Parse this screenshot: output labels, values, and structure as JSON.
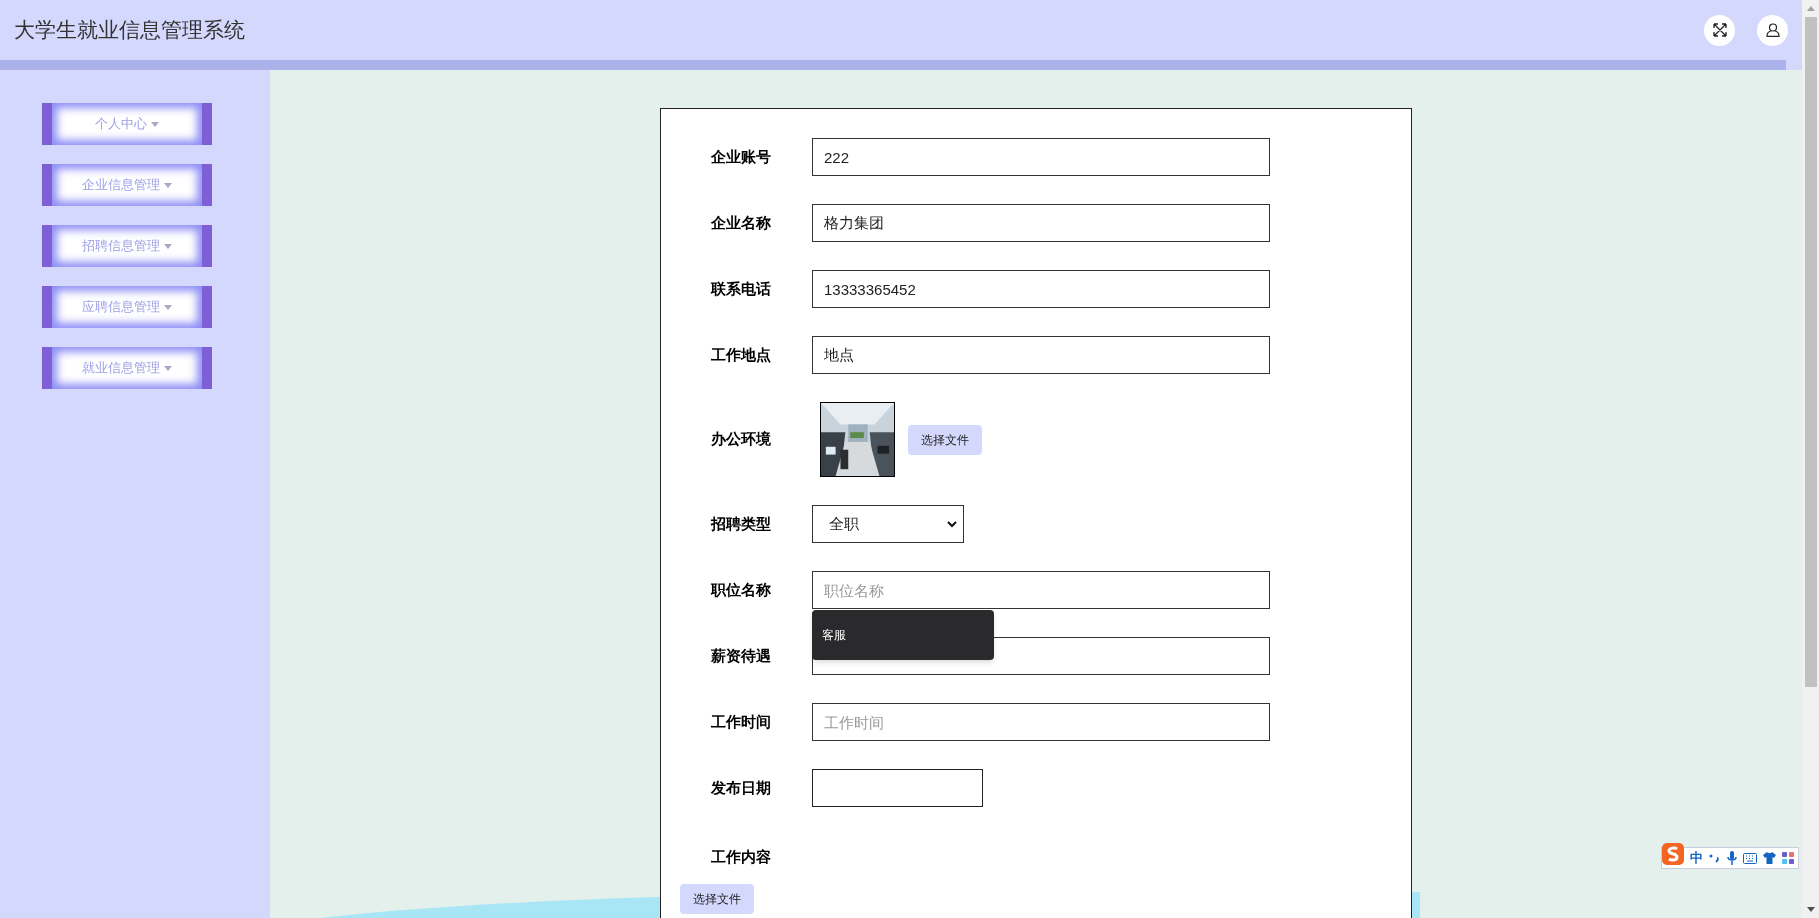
{
  "header": {
    "title": "大学生就业信息管理系统"
  },
  "sidebar": {
    "items": [
      {
        "label": "个人中心"
      },
      {
        "label": "企业信息管理"
      },
      {
        "label": "招聘信息管理"
      },
      {
        "label": "应聘信息管理"
      },
      {
        "label": "就业信息管理"
      }
    ]
  },
  "form": {
    "fields": [
      {
        "kind": "input",
        "label": "企业账号",
        "value": "222"
      },
      {
        "kind": "input",
        "label": "企业名称",
        "value": "格力集团"
      },
      {
        "kind": "input",
        "label": "联系电话",
        "value": "13333365452"
      },
      {
        "kind": "input",
        "label": "工作地点",
        "value": "地点"
      },
      {
        "label": "办公环境",
        "button": "选择文件"
      },
      {
        "kind": "select",
        "label": "招聘类型",
        "value": "全职"
      },
      {
        "kind": "input",
        "label": "职位名称",
        "placeholder": "职位名称",
        "suggestions": [
          "客服"
        ]
      },
      {
        "kind": "input",
        "label": "薪资待遇"
      },
      {
        "kind": "input",
        "label": "工作时间",
        "placeholder": "工作时间"
      },
      {
        "kind": "date",
        "label": "发布日期"
      },
      {
        "kind": "editor",
        "label": "工作内容",
        "button": "选择文件"
      }
    ]
  },
  "ime_toolbar": {
    "mode": "中"
  }
}
